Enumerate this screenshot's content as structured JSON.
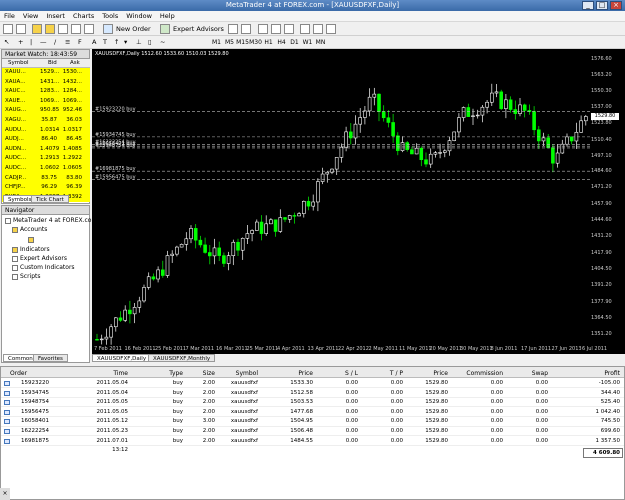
{
  "window": {
    "title": "MetaTrader 4 at FOREX.com - [XAUUSDFXF,Daily]"
  },
  "menu": [
    "File",
    "View",
    "Insert",
    "Charts",
    "Tools",
    "Window",
    "Help"
  ],
  "toolbar": {
    "new_order": "New Order",
    "expert_advisors": "Expert Advisors",
    "timeframes": [
      "M1",
      "M5",
      "M15",
      "M30",
      "H1",
      "H4",
      "D1",
      "W1",
      "MN"
    ]
  },
  "market_watch": {
    "title": "Market Watch: 18:43:59",
    "cols": [
      "Symbol",
      "Bid",
      "Ask"
    ],
    "rows": [
      [
        "XAUU...",
        "1529...",
        "1530..."
      ],
      [
        "XAUA...",
        "1431...",
        "1432..."
      ],
      [
        "XAUC...",
        "1283...",
        "1284..."
      ],
      [
        "XAUE...",
        "1069...",
        "1069..."
      ],
      [
        "XAUG...",
        "950.85",
        "952.46"
      ],
      [
        "XAGU...",
        "35.87",
        "36.03"
      ],
      [
        "AUDU...",
        "1.0314",
        "1.0317"
      ],
      [
        "AUDJ...",
        "86.40",
        "86.45"
      ],
      [
        "AUDN...",
        "1.4079",
        "1.4085"
      ],
      [
        "AUDC...",
        "1.2913",
        "1.2922"
      ],
      [
        "AUDC...",
        "1.0602",
        "1.0605"
      ],
      [
        "CADJP...",
        "83.75",
        "83.80"
      ],
      [
        "CHFJP...",
        "96.29",
        "96.39"
      ],
      [
        "EURA...",
        "1.3387",
        "1.3392"
      ]
    ],
    "tabs": [
      "Symbols",
      "Tick Chart"
    ]
  },
  "navigator": {
    "title": "Navigator",
    "items": [
      "MetaTrader 4 at FOREX.com",
      "Accounts",
      "Indicators",
      "Expert Advisors",
      "Custom Indicators",
      "Scripts"
    ],
    "tabs": [
      "Common",
      "Favorites"
    ]
  },
  "chart": {
    "info": "XAUUSDFXF,Daily  1512.60 1533.60 1510.03 1529.80",
    "yticks": [
      "1576.60",
      "1563.20",
      "1550.30",
      "1537.00",
      "1523.80",
      "1510.40",
      "1497.10",
      "1484.60",
      "1471.20",
      "1457.90",
      "1444.60",
      "1431.20",
      "1417.90",
      "1404.50",
      "1391.20",
      "1377.90",
      "1364.50",
      "1351.20"
    ],
    "xticks": [
      "7 Feb 2011",
      "16 Feb 2011",
      "25 Feb 2011",
      "7 Mar 2011",
      "16 Mar 2011",
      "25 Mar 2011",
      "4 Apr 2011",
      "13 Apr 2011",
      "22 Apr 2012",
      "2 May 2011",
      "11 May 2011",
      "20 May 2011",
      "30 May 2011",
      "8 Jun 2011",
      "17 Jun 2011",
      "27 Jun 2013",
      "6 Jul 2011"
    ],
    "order_lines": [
      {
        "label": "#15923220 buy",
        "price": 1533.3
      },
      {
        "label": "#15934745 buy",
        "price": 1512.58
      },
      {
        "label": "#16222254 buy",
        "price": 1506.48
      },
      {
        "label": "#15948754 buy",
        "price": 1503.53
      },
      {
        "label": "#16058401 buy",
        "price": 1504.95
      },
      {
        "label": "#16981875 buy",
        "price": 1484.55
      },
      {
        "label": "#15956475 buy",
        "price": 1477.68
      }
    ],
    "current_price": "1529.80",
    "tabs": [
      "XAUUSDFXF,Daily",
      "XAUUSDFXF,Monthly"
    ]
  },
  "chart_data": {
    "type": "candlestick",
    "title": "XAUUSDFXF,Daily",
    "ylim": [
      1344,
      1582
    ],
    "xlabel": "",
    "ylabel": "",
    "x": [
      "7 Feb 2011",
      "16 Feb 2011",
      "25 Feb 2011",
      "7 Mar 2011",
      "16 Mar 2011",
      "25 Mar 2011",
      "4 Apr 2011",
      "13 Apr 2011",
      "22 Apr 2012",
      "2 May 2011",
      "11 May 2011",
      "20 May 2011",
      "30 May 2011",
      "8 Jun 2011",
      "17 Jun 2011",
      "27 Jun 2013",
      "6 Jul 2011"
    ],
    "close": [
      1347,
      1372,
      1400,
      1433,
      1412,
      1436,
      1442,
      1463,
      1505,
      1544,
      1501,
      1492,
      1531,
      1544,
      1533,
      1493,
      1529.8
    ]
  },
  "orders": {
    "columns": [
      "Order",
      "Time",
      "Type",
      "Size",
      "Symbol",
      "Price",
      "S / L",
      "T / P",
      "Price",
      "Commission",
      "Swap",
      "Profit"
    ],
    "rows": [
      [
        "15923220",
        "2011.05.04 05:05",
        "buy",
        "2.00",
        "xauusdfxf",
        "1533.30",
        "0.00",
        "0.00",
        "1529.80",
        "0.00",
        "0.00",
        "-105.00"
      ],
      [
        "15934745",
        "2011.05.04 16:39",
        "buy",
        "2.00",
        "xauusdfxf",
        "1512.58",
        "0.00",
        "0.00",
        "1529.80",
        "0.00",
        "0.00",
        "344.40"
      ],
      [
        "15948754",
        "2011.05.05 11:52",
        "buy",
        "2.00",
        "xauusdfxf",
        "1503.53",
        "0.00",
        "0.00",
        "1529.80",
        "0.00",
        "0.00",
        "525.40"
      ],
      [
        "15956475",
        "2011.05.05 17:51",
        "buy",
        "2.00",
        "xauusdfxf",
        "1477.68",
        "0.00",
        "0.00",
        "1529.80",
        "0.00",
        "0.00",
        "1 042.40"
      ],
      [
        "16058401",
        "2011.05.12 04:13",
        "buy",
        "3.00",
        "xauusdfxf",
        "1504.95",
        "0.00",
        "0.00",
        "1529.80",
        "0.00",
        "0.00",
        "745.50"
      ],
      [
        "16222254",
        "2011.05.23 07:39",
        "buy",
        "2.00",
        "xauusdfxf",
        "1506.48",
        "0.00",
        "0.00",
        "1529.80",
        "0.00",
        "0.00",
        "699.60"
      ],
      [
        "16981875",
        "2011.07.01 13:12",
        "buy",
        "2.00",
        "xauusdfxf",
        "1484.55",
        "0.00",
        "0.00",
        "1529.80",
        "0.00",
        "0.00",
        "1 357.50"
      ]
    ],
    "total": "4 609.80"
  },
  "colors": {
    "chart_bg": "#000000",
    "candle_up": "#ffffff",
    "candle_down": "#00ff00",
    "grid": "#1a1a1a",
    "marketwatch_bg": "#ffff00"
  }
}
